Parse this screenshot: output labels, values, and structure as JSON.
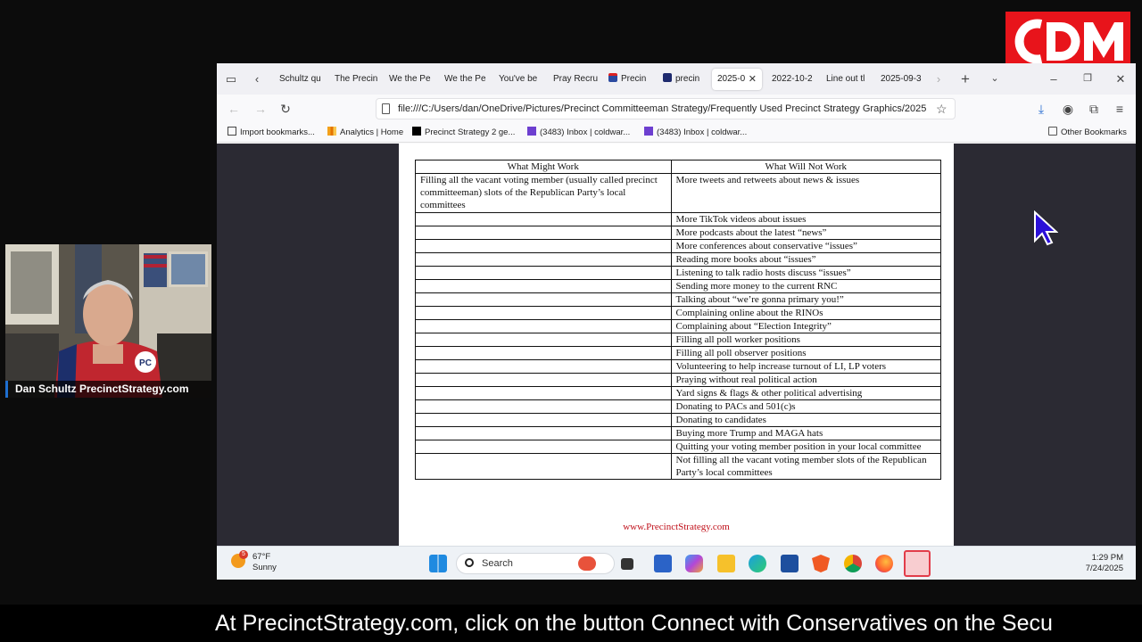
{
  "logo": {
    "icon": "cdm-logo",
    "color": "#e8141b"
  },
  "webcam": {
    "caption": "Dan Schultz PrecinctStrategy.com"
  },
  "browser": {
    "tabs": [
      {
        "label": "Schultz qu",
        "active": false
      },
      {
        "label": "The Precin",
        "active": false
      },
      {
        "label": "We the Pe",
        "active": false
      },
      {
        "label": "We the Pe",
        "active": false
      },
      {
        "label": "You've be",
        "active": false
      },
      {
        "label": "Pray Recru",
        "active": false
      },
      {
        "label": "Precin",
        "active": false,
        "icon": "flag-icon"
      },
      {
        "label": "precin",
        "active": false,
        "icon": "yahoo-icon"
      },
      {
        "label": "2025-0",
        "active": true
      },
      {
        "label": "2022-10-2",
        "active": false
      },
      {
        "label": "Line out tl",
        "active": false
      },
      {
        "label": "2025-09-3",
        "active": false
      }
    ],
    "url": "file:///C:/Users/dan/OneDrive/Pictures/Precinct Committeeman Strategy/Frequently Used Precinct Strategy Graphics/2025",
    "bookmarks": [
      {
        "label": "Import bookmarks...",
        "icon": "import-icon"
      },
      {
        "label": "Analytics | Home",
        "icon": "analytics-icon"
      },
      {
        "label": "Precinct Strategy 2 ge...",
        "icon": "x-icon"
      },
      {
        "label": "(3483) Inbox | coldwar...",
        "icon": "yahoo-mail-icon"
      },
      {
        "label": "(3483) Inbox | coldwar...",
        "icon": "yahoo-mail-icon"
      }
    ],
    "other_bookmarks": "Other Bookmarks"
  },
  "document": {
    "headers": [
      "What Might Work",
      "What Will Not Work"
    ],
    "rows": [
      [
        "Filling all the vacant voting member (usually called precinct committeeman) slots of the Republican Party’s local committees",
        "More tweets and retweets about news & issues"
      ],
      [
        "",
        "More TikTok videos about issues"
      ],
      [
        "",
        "More podcasts about the latest “news”"
      ],
      [
        "",
        "More conferences about conservative “issues”"
      ],
      [
        "",
        "Reading more books about “issues”"
      ],
      [
        "",
        "Listening to talk radio hosts discuss “issues”"
      ],
      [
        "",
        "Sending more money to the current RNC"
      ],
      [
        "",
        "Talking about “we’re gonna primary you!”"
      ],
      [
        "",
        "Complaining online about the RINOs"
      ],
      [
        "",
        "Complaining about “Election Integrity”"
      ],
      [
        "",
        "Filling all poll worker positions"
      ],
      [
        "",
        "Filling all poll observer positions"
      ],
      [
        "",
        "Volunteering to help increase turnout of LI, LP voters"
      ],
      [
        "",
        "Praying without real political action"
      ],
      [
        "",
        "Yard signs & flags & other political advertising"
      ],
      [
        "",
        "Donating to PACs and 501(c)s"
      ],
      [
        "",
        "Donating to candidates"
      ],
      [
        "",
        "Buying more Trump and MAGA hats"
      ],
      [
        "",
        "Quitting your voting member position in your local committee"
      ],
      [
        "",
        "Not filling all the vacant voting member slots of the Republican Party’s local committees"
      ]
    ],
    "footer_link": "www.PrecinctStrategy.com",
    "footer_color": "#c0101a"
  },
  "taskbar": {
    "weather_temp": "67°F",
    "weather_desc": "Sunny",
    "weather_badge": "5",
    "search_label": "Search",
    "time": "1:29 PM",
    "date": "7/24/2025"
  },
  "subtitle": "At PrecinctStrategy.com, click on the button Connect with Conservatives on the Secu"
}
